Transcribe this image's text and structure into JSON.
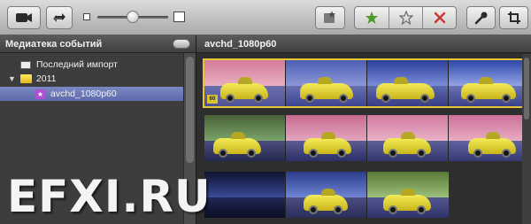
{
  "toolbar": {
    "icons": [
      "camera-icon",
      "swap-icon",
      "clip-size-small-icon",
      "clip-size-large-icon",
      "enhance-icon",
      "favorite-star-icon",
      "unmark-star-icon",
      "reject-icon",
      "voiceover-mic-icon",
      "crop-icon"
    ],
    "accent_green": "#4b9a2a",
    "accent_red": "#c73a33",
    "clip_size_slider": 0.5
  },
  "sidebar": {
    "title": "Медиатека событий",
    "items": [
      {
        "label": "Последний импорт",
        "icon": "last-import-icon"
      },
      {
        "label": "2011",
        "icon": "folder-icon"
      },
      {
        "label": "avchd_1080p60",
        "icon": "event-star-icon",
        "selected": true
      }
    ]
  },
  "main": {
    "title": "avchd_1080p60",
    "badge": "60"
  },
  "watermark": "EFXI.RU"
}
